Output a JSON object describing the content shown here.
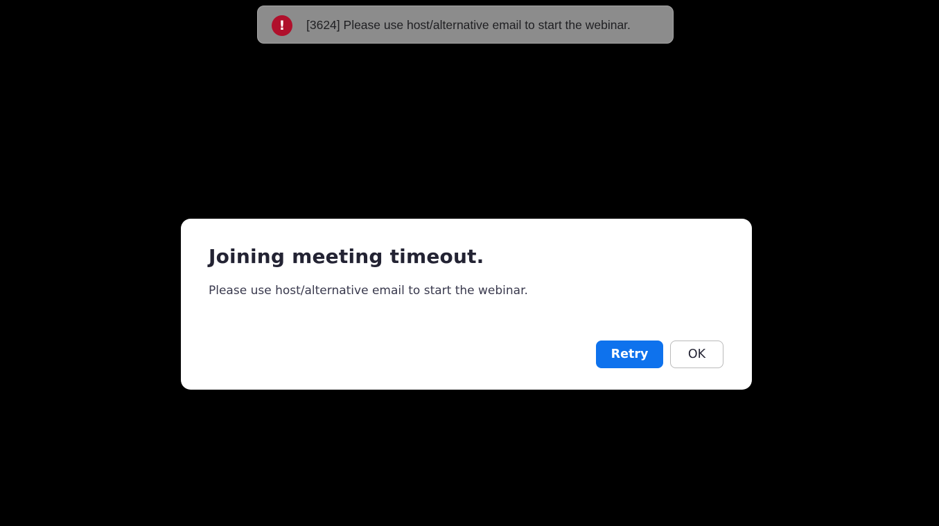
{
  "toast": {
    "icon": "exclamation-icon",
    "icon_glyph": "!",
    "icon_color": "#b0102c",
    "message": "[3624] Please use host/alternative email to start the webinar."
  },
  "dialog": {
    "title": "Joining meeting timeout.",
    "message": "Please use host/alternative email to start the webinar.",
    "retry_label": "Retry",
    "ok_label": "OK",
    "accent_color": "#0e72ed"
  }
}
